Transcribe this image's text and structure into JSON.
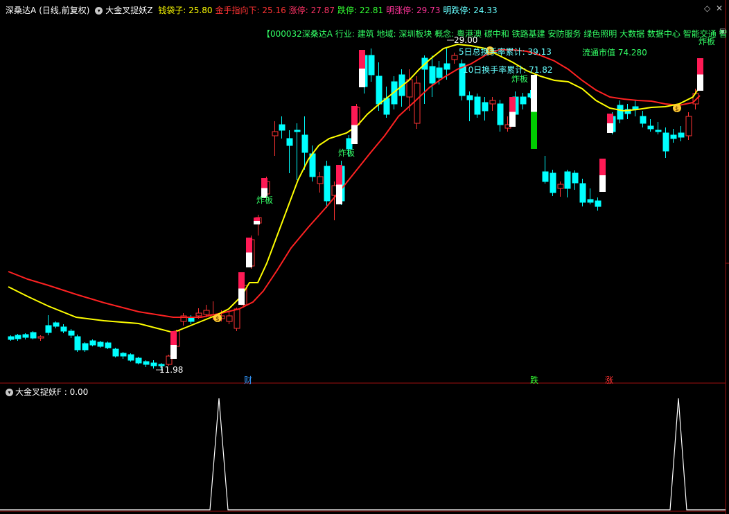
{
  "header": {
    "stock_name": "深桑达A",
    "period": "(日线,前复权)",
    "indicator": "大金叉捉妖Z",
    "fields": [
      {
        "label": "钱袋子: ",
        "value": "25.80",
        "label_color": "#ffff00",
        "value_color": "#ffff00"
      },
      {
        "label": "金手指向下: ",
        "value": "25.16",
        "label_color": "#ff3333",
        "value_color": "#ff3333"
      },
      {
        "label": "涨停: ",
        "value": "27.87",
        "label_color": "#ff3366",
        "value_color": "#ff3366"
      },
      {
        "label": "跌停: ",
        "value": "22.81",
        "label_color": "#33ff33",
        "value_color": "#33ff33"
      },
      {
        "label": "明涨停: ",
        "value": "29.73",
        "label_color": "#ff3399",
        "value_color": "#ff3399"
      },
      {
        "label": "明跌停: ",
        "value": "24.33",
        "label_color": "#66ffff",
        "value_color": "#66ffff"
      }
    ]
  },
  "info_line": "【000032深桑达A  行业: 建筑  地域: 深圳板块  概念: 粤港澳  碳中和  铁路基建  安防服务  绿色照明  大数据  数据中心  智能交通  智",
  "annotations": {
    "high_price": "29.00",
    "low_price": "11.98",
    "turnover_5d": "5日总换手率累计: 39.13",
    "turnover_10d": "10日换手率累计: 71.82",
    "float_cap": "流通市值 74.280",
    "zhaban_1": "炸板",
    "zhaban_2": "炸板",
    "zhaban_3": "炸板",
    "zhaban_4": "炸板"
  },
  "markers": {
    "cai": "财",
    "die": "跌",
    "zhang": "涨"
  },
  "sub_panel": {
    "indicator": "大金叉捉妖F",
    "value_text": " : 0.00"
  },
  "colors": {
    "up": "#ff3333",
    "down": "#00ffff",
    "yellow_ma": "#ffff00",
    "red_ma": "#ff2222",
    "zt_top": "#ff1a55",
    "zt_bottom": "#ffffff",
    "dt_top": "#ffffff",
    "dt_bottom": "#00cc00",
    "divider": "#a01010"
  }
}
